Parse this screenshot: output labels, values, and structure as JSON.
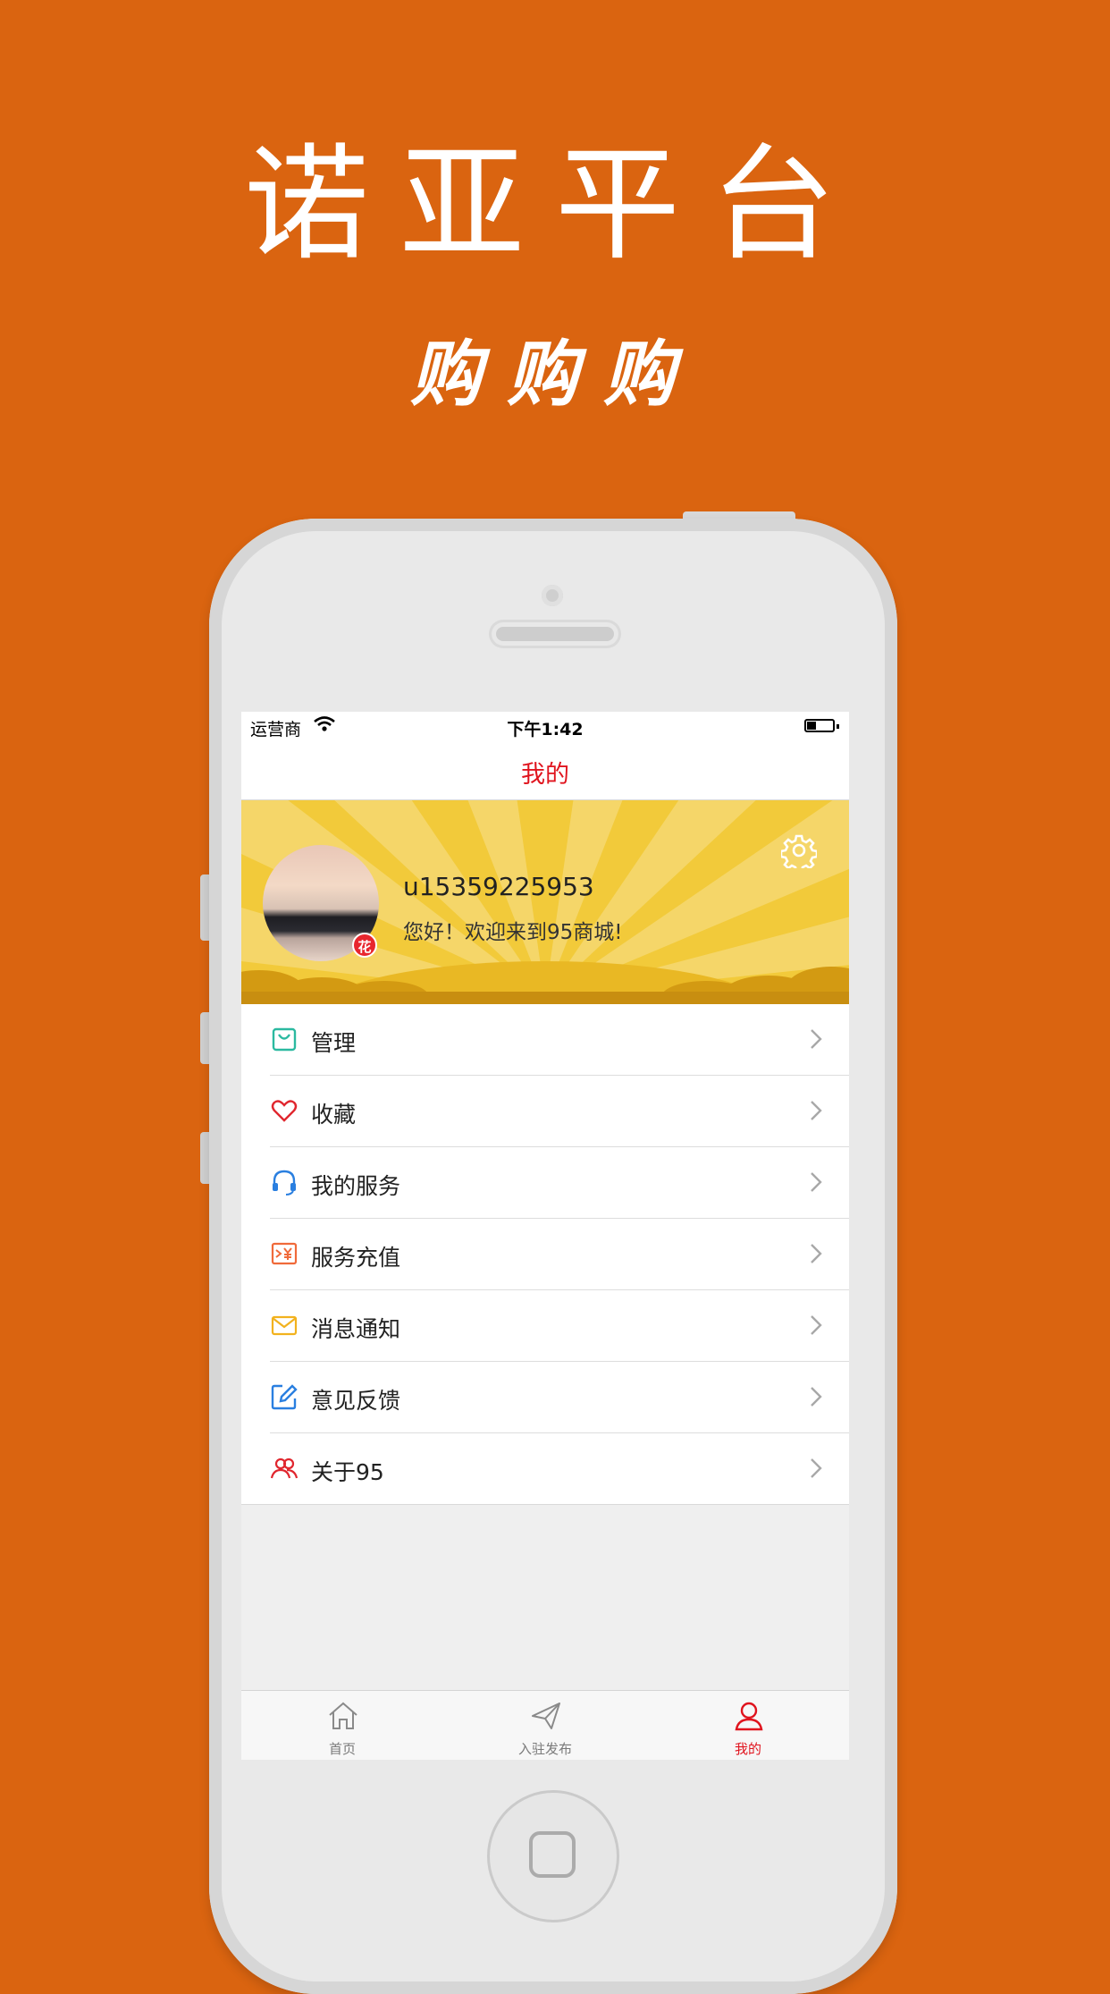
{
  "promo": {
    "headline": "诺亚平台",
    "subline": "购购购"
  },
  "status_bar": {
    "carrier": "运营商",
    "time": "下午1:42",
    "battery_level": 0.35
  },
  "nav": {
    "title": "我的"
  },
  "profile": {
    "username": "u15359225953",
    "welcome": "您好！欢迎来到95商城!",
    "badge": "花"
  },
  "menu": {
    "items": [
      {
        "label": "管理",
        "icon": "shopping-bag-icon",
        "color": "#2BB9A0"
      },
      {
        "label": "收藏",
        "icon": "heart-icon",
        "color": "#E0262E"
      },
      {
        "label": "我的服务",
        "icon": "headset-icon",
        "color": "#2A7FE0"
      },
      {
        "label": "服务充值",
        "icon": "recharge-icon",
        "color": "#F06A3A"
      },
      {
        "label": "消息通知",
        "icon": "envelope-icon",
        "color": "#F2B21E"
      },
      {
        "label": "意见反馈",
        "icon": "edit-icon",
        "color": "#2A7FE0"
      },
      {
        "label": "关于95",
        "icon": "users-icon",
        "color": "#E0262E"
      }
    ]
  },
  "tabbar": {
    "tabs": [
      {
        "label": "首页",
        "icon": "home-icon",
        "active": false
      },
      {
        "label": "入驻发布",
        "icon": "paper-plane-icon",
        "active": false
      },
      {
        "label": "我的",
        "icon": "user-icon",
        "active": true
      }
    ]
  },
  "colors": {
    "background": "#DA6410",
    "accent": "#E0141E",
    "banner": "#F2CA3A"
  }
}
